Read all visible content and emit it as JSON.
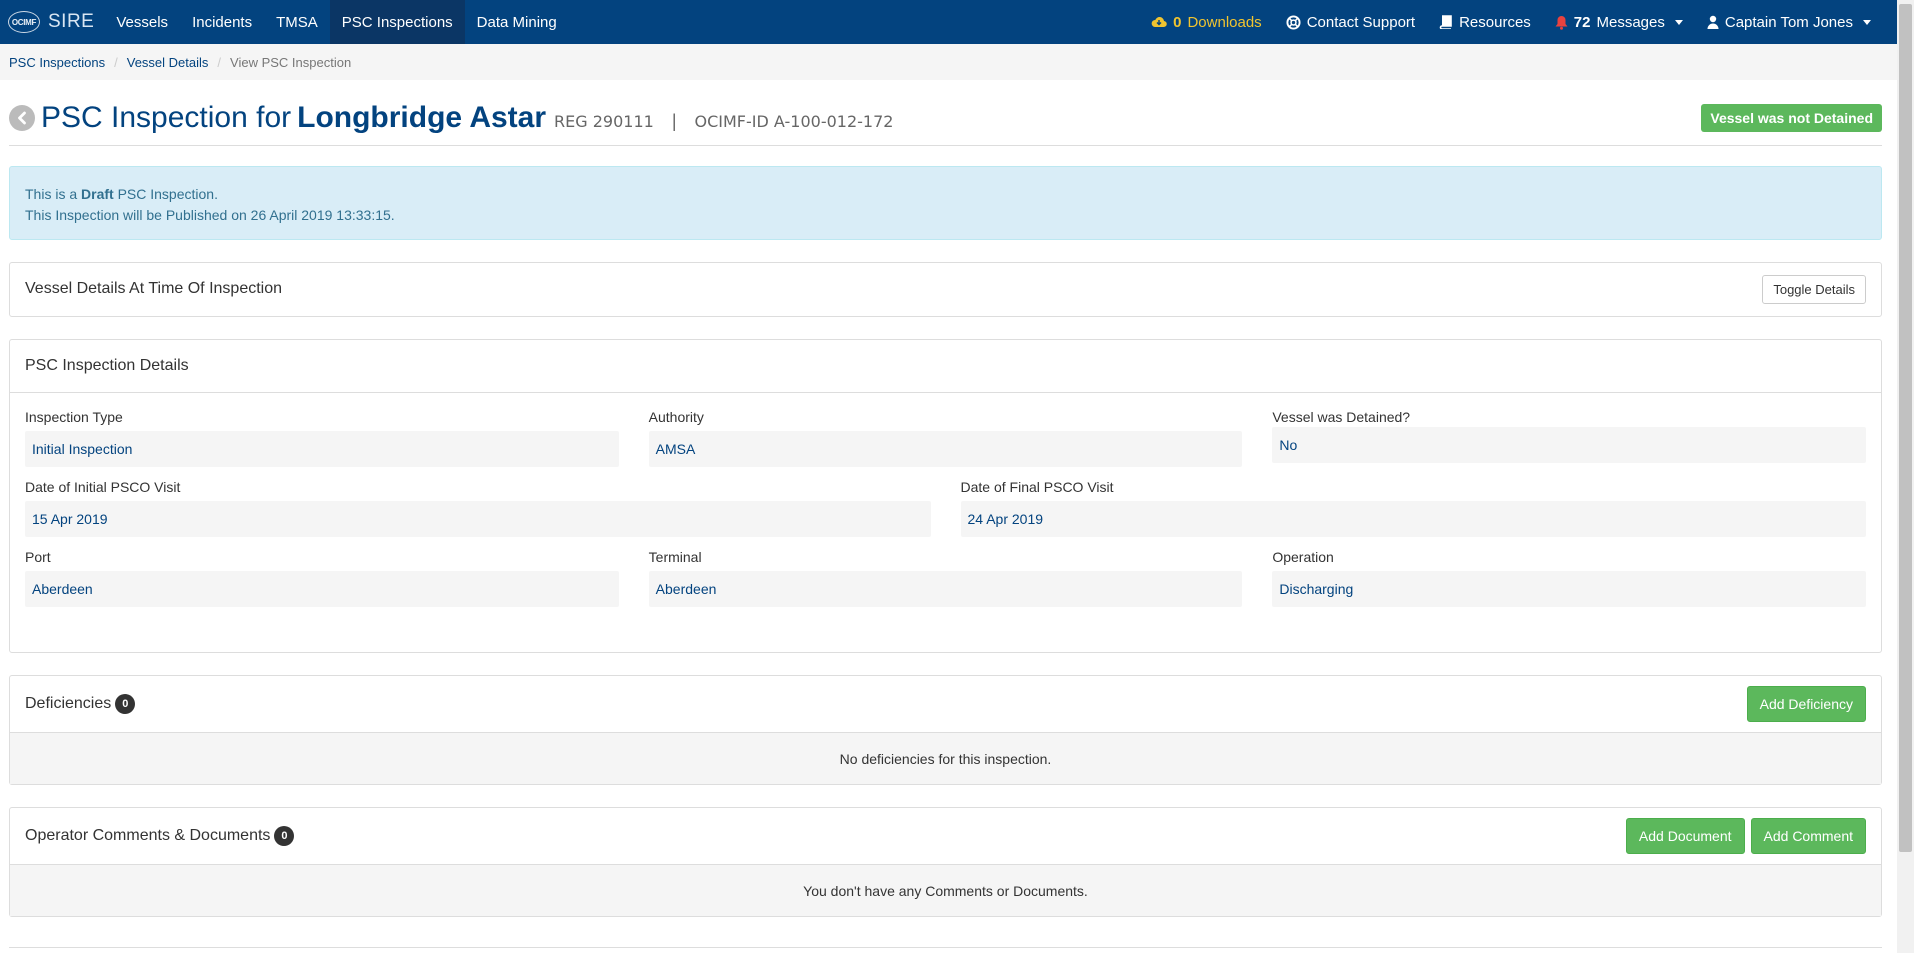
{
  "nav": {
    "brand_logo": "OCIMF",
    "brand_text": "SIRE",
    "items": [
      {
        "label": "Vessels"
      },
      {
        "label": "Incidents"
      },
      {
        "label": "TMSA"
      },
      {
        "label": "PSC Inspections",
        "active": true
      },
      {
        "label": "Data Mining"
      }
    ],
    "downloads_count": "0",
    "downloads_label": "Downloads",
    "contact_support": "Contact Support",
    "resources": "Resources",
    "messages_count": "72",
    "messages_label": "Messages",
    "user": "Captain Tom Jones",
    "colors": {
      "bar": "#03437f",
      "active": "#0b3665",
      "downloads": "#f0c430",
      "bell": "#e8423f"
    }
  },
  "breadcrumb": {
    "items": [
      "PSC Inspections",
      "Vessel Details"
    ],
    "current": "View PSC Inspection"
  },
  "header": {
    "title_prefix": "PSC Inspection for",
    "vessel_name": "Longbridge Astar",
    "reg": "REG 290111",
    "separator": "|",
    "ocimf_id": "OCIMF-ID  A-100-012-172",
    "detained_status": "Vessel was not Detained"
  },
  "alert": {
    "line1_prefix": "This is a ",
    "line1_bold": "Draft",
    "line1_suffix": " PSC Inspection.",
    "line2": "This Inspection will be Published on 26 April 2019 13:33:15."
  },
  "vessel_details_panel": {
    "title": "Vessel Details At Time Of Inspection",
    "toggle_label": "Toggle Details"
  },
  "inspection_details": {
    "title": "PSC Inspection Details",
    "inspection_type_label": "Inspection Type",
    "inspection_type": "Initial Inspection",
    "authority_label": "Authority",
    "authority": "AMSA",
    "detained_label": "Vessel was Detained?",
    "detained": "No",
    "initial_visit_label": "Date of Initial PSCO Visit",
    "initial_visit": "15 Apr 2019",
    "final_visit_label": "Date of Final PSCO Visit",
    "final_visit": "24 Apr 2019",
    "port_label": "Port",
    "port": "Aberdeen",
    "terminal_label": "Terminal",
    "terminal": "Aberdeen",
    "operation_label": "Operation",
    "operation": "Discharging"
  },
  "deficiencies": {
    "title": "Deficiencies",
    "count": "0",
    "add_label": "Add Deficiency",
    "empty": "No deficiencies for this inspection."
  },
  "comments": {
    "title": "Operator Comments & Documents",
    "count": "0",
    "add_document_label": "Add Document",
    "add_comment_label": "Add Comment",
    "empty": "You don't have any Comments or Documents."
  }
}
